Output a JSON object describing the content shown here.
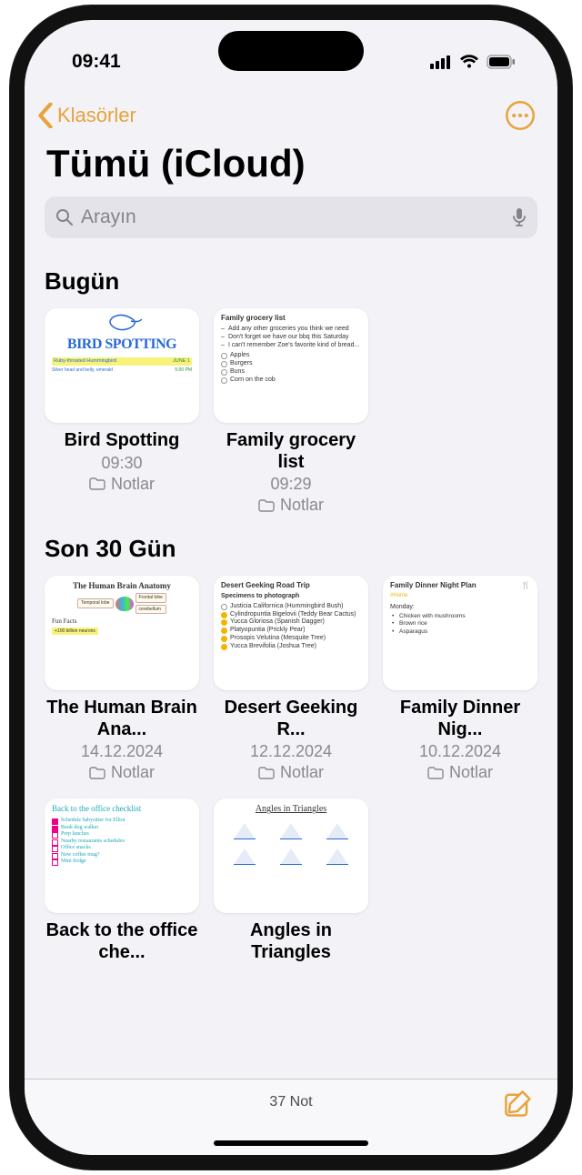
{
  "statusbar": {
    "time": "09:41"
  },
  "nav": {
    "back_label": "Klasörler"
  },
  "page": {
    "title": "Tümü (iCloud)"
  },
  "search": {
    "placeholder": "Arayın"
  },
  "sections": {
    "today": {
      "heading": "Bugün"
    },
    "last30": {
      "heading": "Son 30 Gün"
    }
  },
  "folder_label": "Notlar",
  "notes": {
    "today": [
      {
        "title": "Bird Spotting",
        "time": "09:30"
      },
      {
        "title": "Family grocery list",
        "time": "09:29"
      }
    ],
    "last30": [
      {
        "title": "The Human Brain Ana...",
        "time": "14.12.2024"
      },
      {
        "title": "Desert Geeking R...",
        "time": "12.12.2024"
      },
      {
        "title": "Family Dinner Nig...",
        "time": "10.12.2024"
      },
      {
        "title": "Back to the office che...",
        "time": ""
      },
      {
        "title": "Angles in Triangles",
        "time": ""
      }
    ]
  },
  "thumbs": {
    "grocery": {
      "title": "Family grocery list",
      "lines": [
        "Add any other groceries you think we need",
        "Don't forget we have our bbq this Saturday",
        "I can't remember Zoe's favorite kind of bread..."
      ],
      "checks": [
        "Apples",
        "Burgers",
        "Buns",
        "Corn on the cob"
      ]
    },
    "bird": {
      "main": "BIRD SPOTTING",
      "line1a": "Ruby-throated Hummingbird",
      "line1b": "JUNE 1",
      "line2a": "Silver head and belly, emerald",
      "line2b": "5:00 PM"
    },
    "brain": {
      "title": "The Human Brain Anatomy",
      "tags": [
        "Temporal lobe",
        "Frontal lobe",
        "cerebellum"
      ],
      "fun": "Fun Facts",
      "foot": "+100 billion neurons"
    },
    "desert": {
      "title": "Desert Geeking Road Trip",
      "sub": "Specimens to photograph",
      "items": [
        {
          "t": "Justicia Californica (Hummingbird Bush)",
          "d": false
        },
        {
          "t": "Cylindropuntia Bigelovii (Teddy Bear Cactus)",
          "d": true
        },
        {
          "t": "Yucca Gloriosa (Spanish Dagger)",
          "d": true
        },
        {
          "t": "Platyopuntia (Prickly Pear)",
          "d": true
        },
        {
          "t": "Prosopis Velutina (Mesquite Tree)",
          "d": true
        },
        {
          "t": "Yucca Brevifolia (Joshua Tree)",
          "d": true
        }
      ]
    },
    "dinner": {
      "title": "Family Dinner Night Plan",
      "tag": "#Home",
      "day": "Monday:",
      "items": [
        "Chicken with mushrooms",
        "Brown rice",
        "Asparagus"
      ]
    },
    "office": {
      "title": "Back to the office checklist",
      "items": [
        {
          "t": "Schedule babysitter for Elliot",
          "c": true
        },
        {
          "t": "Book dog walker",
          "c": true
        },
        {
          "t": "Prep lunches",
          "c": false
        },
        {
          "t": "Nearby restaurants schedules",
          "c": false
        },
        {
          "t": "Office snacks",
          "c": false
        },
        {
          "t": "New coffee mug?",
          "c": false
        },
        {
          "t": "Mini fridge",
          "c": false
        }
      ]
    },
    "angles": {
      "title": "Angles in Triangles"
    }
  },
  "toolbar": {
    "count": "37 Not"
  }
}
